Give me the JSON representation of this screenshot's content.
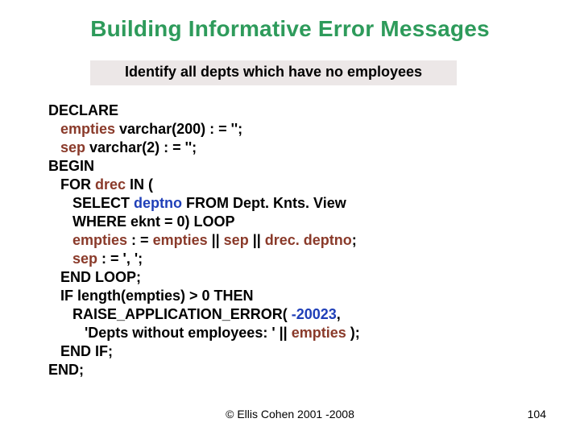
{
  "title": "Building Informative Error Messages",
  "subtitle": "Identify all depts which have no employees",
  "code": {
    "l1": "DECLARE",
    "l2a": "   empties",
    "l2b": " varchar(200) : = '';",
    "l3a": "   sep",
    "l3b": " varchar(2) : = '';",
    "l4": "BEGIN",
    "l5a": "   FOR ",
    "l5b": "drec",
    "l5c": " IN (",
    "l6a": "      SELECT ",
    "l6b": "deptno",
    "l6c": " FROM Dept. Knts. View",
    "l7": "      WHERE eknt = 0) LOOP",
    "l8a": "      empties",
    "l8b": " : = ",
    "l8c": "empties",
    "l8d": " || ",
    "l8e": "sep",
    "l8f": " || ",
    "l8g": "drec. deptno",
    "l8h": ";",
    "l9a": "      sep",
    "l9b": " : = ', ';",
    "l10": "   END LOOP;",
    "l11": "   IF length(empties) > 0 THEN",
    "l12a": "      RAISE_APPLICATION_ERROR( ",
    "l12b": "-20023",
    "l12c": ",",
    "l13a": "         'Depts without employees: ' || ",
    "l13b": "empties",
    "l13c": " );",
    "l14": "   END IF;",
    "l15": "END;"
  },
  "footer": "© Ellis Cohen 2001 -2008",
  "page": "104"
}
